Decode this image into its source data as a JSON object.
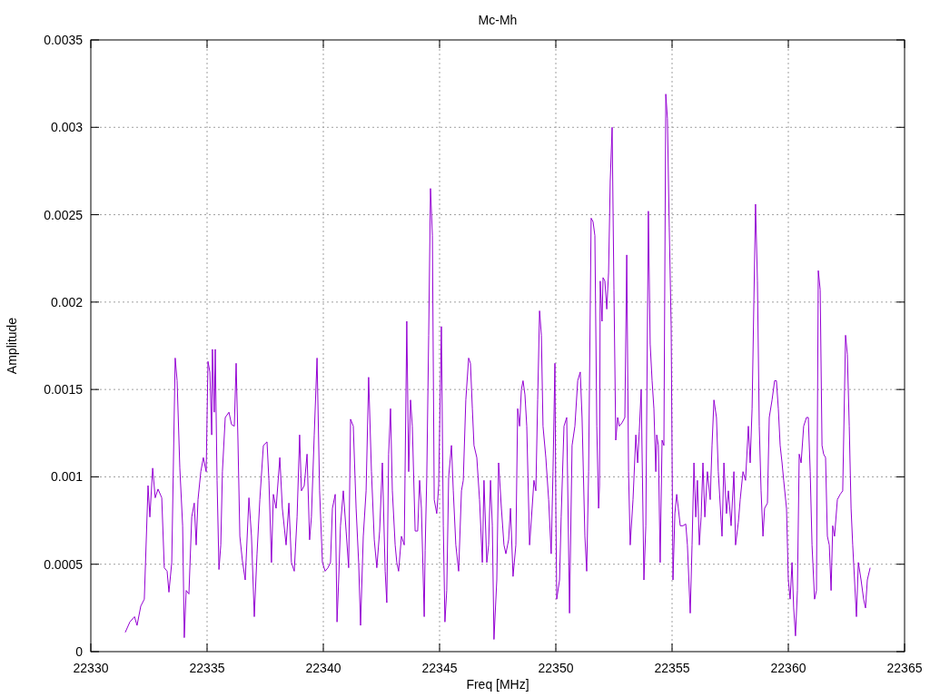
{
  "chart_data": {
    "type": "line",
    "title": "Mc-Mh",
    "xlabel": "Freq [MHz]",
    "ylabel": "Amplitude",
    "xlim": [
      22330,
      22365
    ],
    "ylim": [
      0,
      0.0035
    ],
    "grid": true,
    "xticks": [
      22330,
      22335,
      22340,
      22345,
      22350,
      22355,
      22360,
      22365
    ],
    "yticks": [
      0,
      0.0005,
      0.001,
      0.0015,
      0.002,
      0.0025,
      0.003,
      0.0035
    ],
    "x": [
      22331.48,
      22331.68,
      22331.88,
      22331.99,
      22332.15,
      22332.3,
      22332.46,
      22332.54,
      22332.66,
      22332.77,
      22332.89,
      22333.05,
      22333.16,
      22333.28,
      22333.36,
      22333.48,
      22333.63,
      22333.71,
      22333.83,
      22333.95,
      22334.02,
      22334.1,
      22334.22,
      22334.34,
      22334.45,
      22334.53,
      22334.61,
      22334.73,
      22334.84,
      22334.96,
      22335.04,
      22335.12,
      22335.2,
      22335.23,
      22335.31,
      22335.35,
      22335.43,
      22335.51,
      22335.59,
      22335.66,
      22335.78,
      22335.94,
      22336.05,
      22336.17,
      22336.25,
      22336.33,
      22336.41,
      22336.52,
      22336.64,
      22336.8,
      22336.91,
      22337.03,
      22337.15,
      22337.27,
      22337.42,
      22337.58,
      22337.66,
      22337.77,
      22337.85,
      22337.97,
      22338.13,
      22338.24,
      22338.4,
      22338.52,
      22338.63,
      22338.75,
      22338.87,
      22338.98,
      22339.06,
      22339.18,
      22339.3,
      22339.41,
      22339.49,
      22339.61,
      22339.73,
      22339.84,
      22339.96,
      22340.08,
      22340.2,
      22340.31,
      22340.39,
      22340.51,
      22340.59,
      22340.66,
      22340.74,
      22340.86,
      22340.98,
      22341.09,
      22341.17,
      22341.29,
      22341.41,
      22341.52,
      22341.6,
      22341.72,
      22341.84,
      22341.95,
      22342.07,
      22342.19,
      22342.3,
      22342.42,
      22342.54,
      22342.66,
      22342.73,
      22342.81,
      22342.89,
      22342.97,
      22343.09,
      22343.16,
      22343.24,
      22343.36,
      22343.48,
      22343.59,
      22343.67,
      22343.75,
      22343.83,
      22343.95,
      22344.06,
      22344.14,
      22344.22,
      22344.34,
      22344.38,
      22344.45,
      22344.53,
      22344.61,
      22344.69,
      22344.77,
      22344.88,
      22344.96,
      22345.08,
      22345.16,
      22345.23,
      22345.31,
      22345.39,
      22345.51,
      22345.59,
      22345.7,
      22345.82,
      22345.94,
      22346.02,
      22346.13,
      22346.25,
      22346.33,
      22346.41,
      22346.48,
      22346.6,
      22346.72,
      22346.84,
      22346.91,
      22347.03,
      22347.11,
      22347.19,
      22347.27,
      22347.34,
      22347.46,
      22347.54,
      22347.66,
      22347.77,
      22347.85,
      22347.97,
      22348.05,
      22348.16,
      22348.28,
      22348.36,
      22348.44,
      22348.52,
      22348.59,
      22348.67,
      22348.75,
      22348.87,
      22348.98,
      22349.06,
      22349.14,
      22349.22,
      22349.3,
      22349.38,
      22349.45,
      22349.57,
      22349.69,
      22349.8,
      22349.88,
      22349.96,
      22350.0,
      22350.04,
      22350.16,
      22350.23,
      22350.35,
      22350.47,
      22350.59,
      22350.7,
      22350.82,
      22350.94,
      22351.05,
      22351.13,
      22351.25,
      22351.33,
      22351.41,
      22351.52,
      22351.6,
      22351.68,
      22351.76,
      22351.84,
      22351.88,
      22351.91,
      22351.99,
      22352.03,
      22352.11,
      22352.19,
      22352.27,
      22352.34,
      22352.42,
      22352.5,
      22352.58,
      22352.66,
      22352.73,
      22352.85,
      22352.97,
      22353.05,
      22353.13,
      22353.2,
      22353.32,
      22353.44,
      22353.52,
      22353.59,
      22353.67,
      22353.79,
      22353.87,
      22353.98,
      22354.06,
      22354.14,
      22354.22,
      22354.3,
      22354.34,
      22354.41,
      22354.49,
      22354.57,
      22354.65,
      22354.73,
      22354.8,
      22354.88,
      22354.96,
      22355.04,
      22355.12,
      22355.2,
      22355.27,
      22355.35,
      22355.47,
      22355.59,
      22355.66,
      22355.78,
      22355.86,
      22355.94,
      22356.02,
      22356.09,
      22356.17,
      22356.25,
      22356.33,
      22356.41,
      22356.52,
      22356.64,
      22356.72,
      22356.8,
      22356.91,
      22356.99,
      22357.15,
      22357.23,
      22357.34,
      22357.42,
      22357.54,
      22357.66,
      22357.73,
      22357.85,
      22357.93,
      22358.05,
      22358.16,
      22358.28,
      22358.36,
      22358.44,
      22358.52,
      22358.59,
      22358.67,
      22358.75,
      22358.83,
      22358.91,
      22358.98,
      22359.1,
      22359.18,
      22359.3,
      22359.41,
      22359.49,
      22359.57,
      22359.65,
      22359.73,
      22359.8,
      22359.92,
      22360.0,
      22360.08,
      22360.16,
      22360.23,
      22360.31,
      22360.39,
      22360.47,
      22360.55,
      22360.66,
      22360.78,
      22360.86,
      22360.94,
      22361.02,
      22361.13,
      22361.21,
      22361.29,
      22361.37,
      22361.45,
      22361.52,
      22361.6,
      22361.68,
      22361.76,
      22361.84,
      22361.91,
      22361.99,
      22362.11,
      22362.23,
      22362.34,
      22362.46,
      22362.54,
      22362.62,
      22362.7,
      22362.77,
      22362.93,
      22363.01,
      22363.13,
      22363.24,
      22363.32,
      22363.4,
      22363.52
    ],
    "series": [
      {
        "color": "#9400d3",
        "values": [
          0.00011,
          0.00017,
          0.0002,
          0.00015,
          0.00026,
          0.0003,
          0.00095,
          0.00077,
          0.00105,
          0.00088,
          0.00093,
          0.00088,
          0.00048,
          0.00046,
          0.00034,
          0.00051,
          0.00168,
          0.00155,
          0.00105,
          0.00072,
          8e-05,
          0.00035,
          0.00033,
          0.00077,
          0.00085,
          0.00061,
          0.00087,
          0.00103,
          0.00111,
          0.00103,
          0.00166,
          0.0016,
          0.00124,
          0.00173,
          0.00137,
          0.00173,
          0.00098,
          0.00047,
          0.00061,
          0.00103,
          0.00134,
          0.00137,
          0.0013,
          0.00129,
          0.00165,
          0.00121,
          0.00066,
          0.00052,
          0.00041,
          0.00088,
          0.00066,
          0.0002,
          0.00056,
          0.00087,
          0.00118,
          0.0012,
          0.00098,
          0.00051,
          0.0009,
          0.00082,
          0.00111,
          0.00082,
          0.00061,
          0.00085,
          0.00051,
          0.00046,
          0.00077,
          0.00124,
          0.00092,
          0.00095,
          0.00113,
          0.00064,
          0.00077,
          0.00124,
          0.00168,
          0.00092,
          0.00051,
          0.00046,
          0.00048,
          0.00051,
          0.00082,
          0.0009,
          0.00017,
          0.00041,
          0.00072,
          0.00092,
          0.00069,
          0.00048,
          0.00133,
          0.00129,
          0.00082,
          0.00051,
          0.00015,
          0.00066,
          0.00092,
          0.00157,
          0.00103,
          0.00064,
          0.00048,
          0.00069,
          0.00108,
          0.00046,
          0.00028,
          0.00113,
          0.00139,
          0.00092,
          0.00061,
          0.00051,
          0.00046,
          0.00066,
          0.00061,
          0.00189,
          0.00103,
          0.00144,
          0.00129,
          0.00069,
          0.00069,
          0.00098,
          0.00082,
          0.0002,
          0.00058,
          0.001,
          0.00181,
          0.00265,
          0.00238,
          0.00087,
          0.00079,
          0.00095,
          0.00186,
          0.00072,
          0.00017,
          0.00035,
          0.001,
          0.00118,
          0.00092,
          0.00061,
          0.00046,
          0.00092,
          0.00098,
          0.00144,
          0.00168,
          0.00165,
          0.00139,
          0.00118,
          0.00111,
          0.00087,
          0.00051,
          0.00098,
          0.00051,
          0.00061,
          0.00098,
          0.00072,
          7e-05,
          0.00041,
          0.00108,
          0.00082,
          0.00061,
          0.00056,
          0.00064,
          0.00082,
          0.00043,
          0.00061,
          0.00139,
          0.00129,
          0.0015,
          0.00155,
          0.00147,
          0.00129,
          0.00061,
          0.00082,
          0.00098,
          0.00092,
          0.00144,
          0.00195,
          0.00181,
          0.00129,
          0.00111,
          0.00087,
          0.00056,
          0.00103,
          0.00165,
          0.00082,
          0.0003,
          0.00041,
          0.00077,
          0.00129,
          0.00134,
          0.00022,
          0.00118,
          0.00129,
          0.00155,
          0.0016,
          0.00134,
          0.00066,
          0.00046,
          0.00103,
          0.00248,
          0.00246,
          0.00238,
          0.00129,
          0.00082,
          0.00095,
          0.00212,
          0.00189,
          0.00214,
          0.00212,
          0.00196,
          0.00217,
          0.00269,
          0.003,
          0.00207,
          0.00121,
          0.00134,
          0.00129,
          0.00131,
          0.00134,
          0.00227,
          0.00103,
          0.00061,
          0.00087,
          0.00124,
          0.00108,
          0.00126,
          0.0015,
          0.00041,
          0.00072,
          0.00252,
          0.00176,
          0.00155,
          0.00139,
          0.00103,
          0.00124,
          0.00118,
          0.00051,
          0.00121,
          0.00118,
          0.00319,
          0.00305,
          0.00243,
          0.00186,
          0.00041,
          0.00079,
          0.0009,
          0.00082,
          0.00072,
          0.00072,
          0.00073,
          0.00061,
          0.00022,
          0.00061,
          0.00108,
          0.00077,
          0.00098,
          0.00061,
          0.00077,
          0.00108,
          0.00077,
          0.00103,
          0.00087,
          0.00118,
          0.00144,
          0.00134,
          0.00103,
          0.00066,
          0.00108,
          0.00079,
          0.00092,
          0.00072,
          0.00103,
          0.00061,
          0.00074,
          0.00087,
          0.00103,
          0.00098,
          0.00129,
          0.00108,
          0.00139,
          0.00201,
          0.00256,
          0.00212,
          0.00129,
          0.00092,
          0.00066,
          0.00082,
          0.00085,
          0.00134,
          0.00144,
          0.00155,
          0.00155,
          0.00139,
          0.00118,
          0.00108,
          0.00098,
          0.00082,
          0.00041,
          0.0003,
          0.00051,
          0.00025,
          9e-05,
          0.00035,
          0.00113,
          0.00108,
          0.00129,
          0.00134,
          0.00134,
          0.00103,
          0.00061,
          0.0003,
          0.00035,
          0.00218,
          0.00207,
          0.00118,
          0.00113,
          0.00111,
          0.00066,
          0.00061,
          0.00035,
          0.00072,
          0.00066,
          0.00087,
          0.0009,
          0.00092,
          0.00181,
          0.0017,
          0.00129,
          0.00082,
          0.00061,
          0.0002,
          0.00051,
          0.00041,
          0.0003,
          0.00025,
          0.00041,
          0.00048
        ]
      }
    ]
  }
}
